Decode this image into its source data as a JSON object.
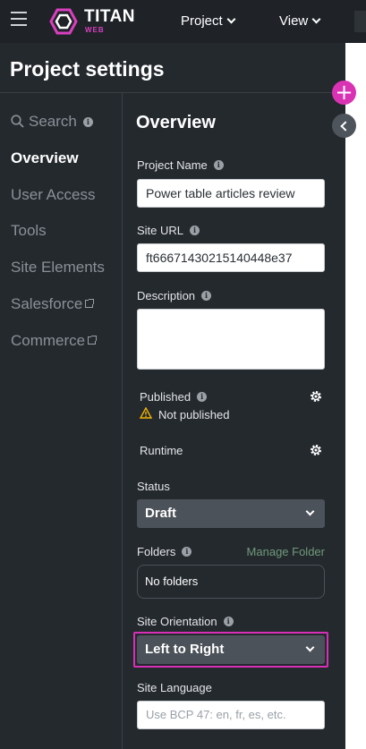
{
  "topbar": {
    "brand_title": "TITAN",
    "brand_sub": "WEB",
    "nav": [
      {
        "label": "Project"
      },
      {
        "label": "View"
      }
    ]
  },
  "panel": {
    "title": "Project settings",
    "sidebar": {
      "items": [
        {
          "label": "Search"
        },
        {
          "label": "Overview"
        },
        {
          "label": "User Access"
        },
        {
          "label": "Tools"
        },
        {
          "label": "Site Elements"
        },
        {
          "label": "Salesforce"
        },
        {
          "label": "Commerce"
        }
      ]
    },
    "overview": {
      "title": "Overview",
      "project_name": {
        "label": "Project Name",
        "value": "Power table articles review"
      },
      "site_url": {
        "label": "Site URL",
        "value": "ft66671430215140448e37"
      },
      "description": {
        "label": "Description",
        "value": ""
      },
      "published": {
        "label": "Published",
        "status": "Not published"
      },
      "runtime": {
        "label": "Runtime"
      },
      "status": {
        "label": "Status",
        "value": "Draft"
      },
      "folders": {
        "label": "Folders",
        "manage": "Manage Folder",
        "value": "No folders"
      },
      "site_orientation": {
        "label": "Site Orientation",
        "value": "Left to Right"
      },
      "site_language": {
        "label": "Site Language",
        "placeholder": "Use BCP 47: en, fr, es, etc."
      }
    }
  },
  "icon_info": "i",
  "fab_plus": "+",
  "colors": {
    "topbar": "#1f2328",
    "panel": "#24292e",
    "accent": "#d933b4",
    "manage_link": "#6f9a7a",
    "warning": "#f0b400"
  }
}
